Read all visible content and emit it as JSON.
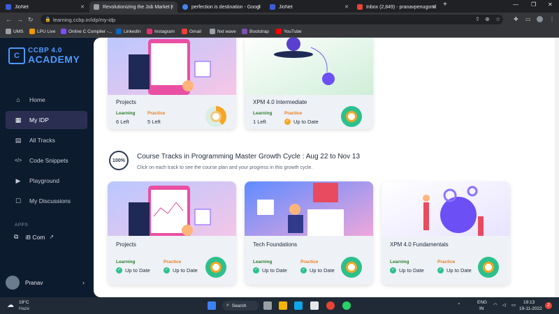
{
  "browser": {
    "tabs": [
      {
        "title": "JioNet",
        "color": "#3b5bdb"
      },
      {
        "title": "Revolutionizing the Job Market | ",
        "color": "#9aa0a6",
        "active": true
      },
      {
        "title": "perfection is destination - Googl",
        "color": "#4285f4"
      },
      {
        "title": "JioNet",
        "color": "#3b5bdb"
      },
      {
        "title": "Inbox (2,849) - pranavpenugond",
        "color": "#ea4335"
      }
    ],
    "new_tab": "+",
    "url": "learning.ccbp.in/idp/my-idp",
    "bookmarks": [
      {
        "label": "UMS",
        "color": "#9aa0a6"
      },
      {
        "label": "LPU Live",
        "color": "#f29900"
      },
      {
        "label": "Online C Compiler -...",
        "color": "#7c4dff"
      },
      {
        "label": "LinkedIn",
        "color": "#0a66c2"
      },
      {
        "label": "Instagram",
        "color": "#e1306c"
      },
      {
        "label": "Gmail",
        "color": "#ea4335"
      },
      {
        "label": "Nxt wave",
        "color": "#9aa0a6"
      },
      {
        "label": "Bootstrap",
        "color": "#7952b3"
      },
      {
        "label": "YouTube",
        "color": "#ff0000"
      }
    ]
  },
  "sidebar": {
    "logo_line1": "CCBP 4.0",
    "logo_line2": "ACADEMY",
    "items": [
      {
        "label": "Home",
        "icon": "⌂",
        "active": false
      },
      {
        "label": "My IDP",
        "icon": "▦",
        "active": true
      },
      {
        "label": "All Tracks",
        "icon": "▤",
        "active": false
      },
      {
        "label": "Code Snippets",
        "icon": "</>",
        "active": false
      },
      {
        "label": "Playground",
        "icon": "▶",
        "active": false
      },
      {
        "label": "My Discussions",
        "icon": "☐",
        "active": false
      }
    ],
    "apps_label": "APPS",
    "ibcom_label": "iB Com",
    "user_name": "Pranav"
  },
  "top_cards": [
    {
      "title": "Projects",
      "learning_label": "Learning",
      "learning_value": "6 Left",
      "practice_label": "Practice",
      "practice_value": "5 Left",
      "progress": 0.4
    },
    {
      "title": "XPM 4.0 Intermediate",
      "learning_label": "Learning",
      "learning_value": "1 Left",
      "practice_label": "Practice",
      "practice_value": "Up to Date",
      "progress": 1.0
    }
  ],
  "section": {
    "badge": "100%",
    "title": "Course Tracks in Programming Master Growth Cycle : Aug 22 to Nov 13",
    "subtitle": "Click on each track to see the course plan and your progress in this growth cycle."
  },
  "track_cards": [
    {
      "title": "Projects",
      "learning_label": "Learning",
      "learning_value": "Up to Date",
      "practice_label": "Practice",
      "practice_value": "Up to Date"
    },
    {
      "title": "Tech Foundations",
      "learning_label": "Learning",
      "learning_value": "Up to Date",
      "practice_label": "Practice",
      "practice_value": "Up to Date"
    },
    {
      "title": "XPM 4.0 Fundamentals",
      "learning_label": "Learning",
      "learning_value": "Up to Date",
      "practice_label": "Practice",
      "practice_value": "Up to Date"
    }
  ],
  "taskbar": {
    "weather_temp": "19°C",
    "weather_desc": "Haze",
    "search_label": "Search",
    "lang_line1": "ENG",
    "lang_line2": "IN",
    "time": "19:13",
    "date": "19-11-2022",
    "notif_count": "2"
  },
  "colors": {
    "learning": "#2e7d32",
    "practice": "#e67e22",
    "accent": "#4a9bff"
  }
}
